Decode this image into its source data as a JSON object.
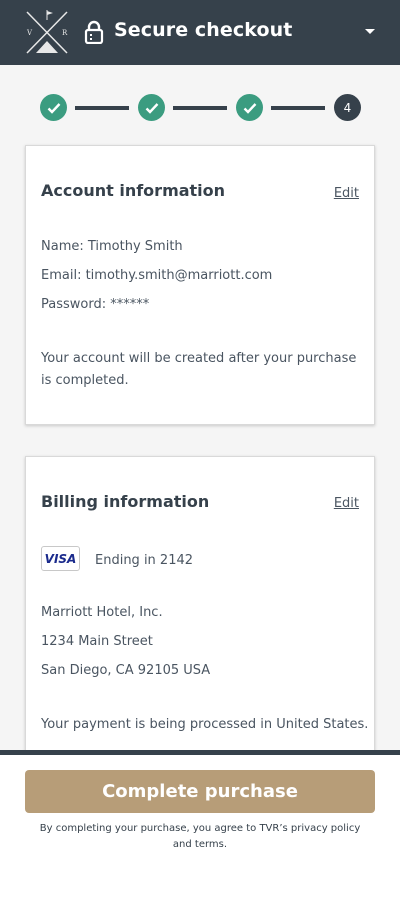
{
  "header": {
    "logo_letters": [
      "V",
      "R"
    ],
    "title": "Secure checkout",
    "lock_icon": "lock-icon",
    "caret_icon": "chevron-down-icon"
  },
  "stepper": {
    "steps": [
      {
        "status": "done",
        "icon": "check-icon"
      },
      {
        "status": "done",
        "icon": "check-icon"
      },
      {
        "status": "done",
        "icon": "check-icon"
      },
      {
        "status": "current",
        "label": "4"
      }
    ]
  },
  "account": {
    "title": "Account information",
    "edit_label": "Edit",
    "name": "Name: Timothy Smith",
    "email": "Email: timothy.smith@marriott.com",
    "password": "Password: ******",
    "note": "Your account will be created after your purchase is completed."
  },
  "billing": {
    "title": "Billing information",
    "edit_label": "Edit",
    "card_brand": "VISA",
    "card_ending": "Ending in 2142",
    "company": "Marriott Hotel, Inc.",
    "street": "1234 Main Street",
    "city_line": "San Diego, CA 92105 USA",
    "note": "Your payment is being processed in United States."
  },
  "footer": {
    "button_label": "Complete purchase",
    "terms": "By completing your purchase, you agree to TVR’s privacy policy and terms."
  },
  "colors": {
    "header_bg": "#36414b",
    "step_done": "#3b9c80",
    "button_bg": "#b79d78"
  }
}
